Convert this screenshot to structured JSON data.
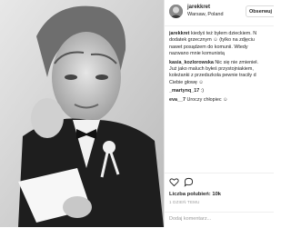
{
  "post": {
    "username": "jarekkret",
    "location": "Warsaw, Poland",
    "follow_label": "Obserwuj",
    "comments": [
      {
        "user": "jarekkret",
        "lines": [
          " kiedyś też byłem dzieckiem. N",
          "dodatek grzecznym ☺ (tylko na zdjęciu",
          "nawet posądzem do komunii. Wtedy",
          "nazwano mnie komunistą"
        ]
      },
      {
        "user": "kasia_kozlorowska",
        "lines": [
          " Nic się nie zmienieł.",
          "Już jako maluch byłeś przystojniakiem,",
          "koleżanki z przedszkola pewnie traciły d",
          "Ciebie głowę ☺"
        ]
      },
      {
        "user": "_martynq_17",
        "lines": [
          " :)"
        ]
      },
      {
        "user": "eva__7",
        "lines": [
          " Uroczy chłopiec ☺"
        ]
      }
    ],
    "likes_label": "Liczba polubień: 10k",
    "date": "1 DZIEŃ TEMU",
    "add_comment_placeholder": "Dodaj komentarz..."
  },
  "icons": {
    "like": "heart-icon",
    "comment": "comment-icon"
  }
}
